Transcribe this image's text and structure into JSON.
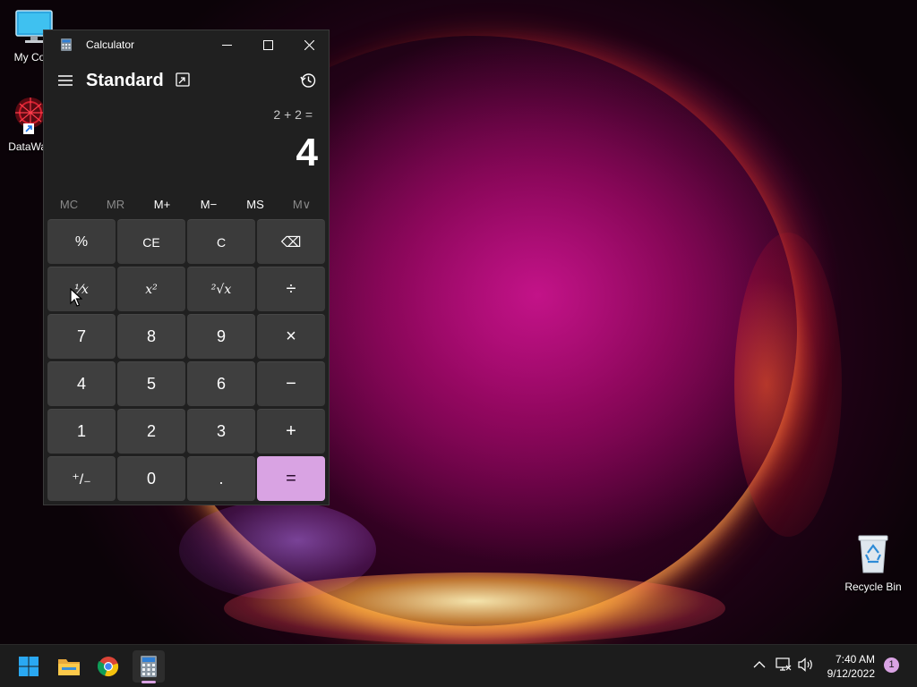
{
  "desktop": {
    "icons": [
      {
        "label": "My Com",
        "icon": "computer-icon"
      },
      {
        "label": "DataWag",
        "icon": "datawag-icon"
      },
      {
        "label": "Recycle Bin",
        "icon": "recycle-bin-icon"
      }
    ]
  },
  "calculator": {
    "window_title": "Calculator",
    "mode": "Standard",
    "expression": "2 + 2 =",
    "result": "4",
    "memory_buttons": [
      {
        "label": "MC",
        "enabled": false
      },
      {
        "label": "MR",
        "enabled": false
      },
      {
        "label": "M+",
        "enabled": true
      },
      {
        "label": "M−",
        "enabled": true
      },
      {
        "label": "MS",
        "enabled": true
      },
      {
        "label": "M∨",
        "enabled": false
      }
    ],
    "keys": {
      "percent": "%",
      "ce": "CE",
      "c": "C",
      "backspace": "⌫",
      "reciprocal": "⅟x",
      "square": "x²",
      "sqrt": "²√x",
      "divide": "÷",
      "seven": "7",
      "eight": "8",
      "nine": "9",
      "multiply": "×",
      "four": "4",
      "five": "5",
      "six": "6",
      "minus": "−",
      "one": "1",
      "two": "2",
      "three": "3",
      "plus": "+",
      "negate": "⁺/₋",
      "zero": "0",
      "decimal": ".",
      "equals": "="
    },
    "colors": {
      "accent": "#d9a3e3",
      "window_bg": "#202020",
      "key_bg": "#3b3b3b"
    }
  },
  "taskbar": {
    "pinned": [
      {
        "name": "start-button",
        "icon": "windows-logo-icon"
      },
      {
        "name": "file-explorer",
        "icon": "folder-icon"
      },
      {
        "name": "chrome",
        "icon": "chrome-icon"
      },
      {
        "name": "calculator",
        "icon": "calculator-icon",
        "active": true
      }
    ],
    "clock": {
      "time": "7:40 AM",
      "date": "9/12/2022"
    },
    "notification_count": "1"
  }
}
